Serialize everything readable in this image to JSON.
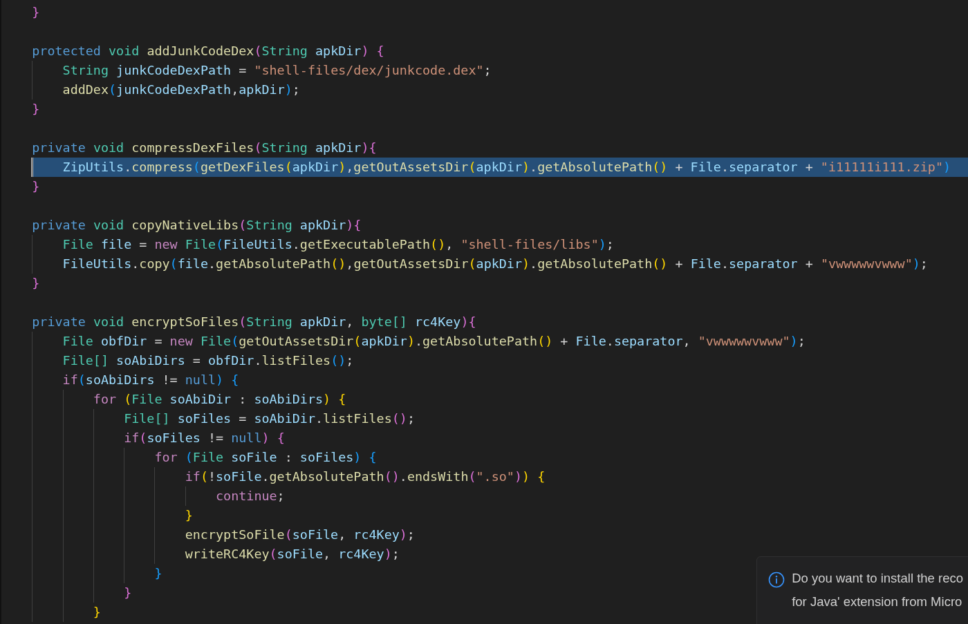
{
  "editor": {
    "lines": [
      {
        "selected": false,
        "tokens": [
          {
            "kind": "m",
            "text": "    }"
          }
        ]
      },
      {
        "selected": false
      },
      {
        "selected": false,
        "tokens": [
          {
            "kind": "mod",
            "text": "    protected "
          },
          {
            "kind": "type",
            "text": "void "
          },
          {
            "kind": "fn",
            "text": "addJunkCodeDex"
          },
          {
            "kind": "m",
            "text": "("
          },
          {
            "kind": "type",
            "text": "String "
          },
          {
            "kind": "var",
            "text": "apkDir"
          },
          {
            "kind": "m",
            "text": ") "
          },
          {
            "kind": "m",
            "text": "{"
          }
        ]
      },
      {
        "selected": false,
        "tokens": [
          {
            "kind": "type",
            "text": "        String "
          },
          {
            "kind": "var",
            "text": "junkCodeDexPath"
          },
          {
            "kind": "p",
            "text": " = "
          },
          {
            "kind": "str",
            "text": "\"shell-files/dex/junkcode.dex\""
          },
          {
            "kind": "p",
            "text": ";"
          }
        ]
      },
      {
        "selected": false,
        "tokens": [
          {
            "kind": "fn",
            "text": "        addDex"
          },
          {
            "kind": "c",
            "text": "("
          },
          {
            "kind": "var",
            "text": "junkCodeDexPath"
          },
          {
            "kind": "p",
            "text": ","
          },
          {
            "kind": "var",
            "text": "apkDir"
          },
          {
            "kind": "c",
            "text": ")"
          },
          {
            "kind": "p",
            "text": ";"
          }
        ]
      },
      {
        "selected": false,
        "tokens": [
          {
            "kind": "m",
            "text": "    }"
          }
        ]
      },
      {
        "selected": false
      },
      {
        "selected": false,
        "tokens": [
          {
            "kind": "mod",
            "text": "    private "
          },
          {
            "kind": "type",
            "text": "void "
          },
          {
            "kind": "fn",
            "text": "compressDexFiles"
          },
          {
            "kind": "m",
            "text": "("
          },
          {
            "kind": "type",
            "text": "String "
          },
          {
            "kind": "var",
            "text": "apkDir"
          },
          {
            "kind": "m",
            "text": "){"
          }
        ]
      },
      {
        "selected": true,
        "tokens": [
          {
            "kind": "var",
            "text": "        ZipUtils"
          },
          {
            "kind": "p",
            "text": "."
          },
          {
            "kind": "fn",
            "text": "compress"
          },
          {
            "kind": "c",
            "text": "("
          },
          {
            "kind": "fn",
            "text": "getDexFiles"
          },
          {
            "kind": "y",
            "text": "("
          },
          {
            "kind": "var",
            "text": "apkDir"
          },
          {
            "kind": "y",
            "text": ")"
          },
          {
            "kind": "p",
            "text": ","
          },
          {
            "kind": "fn",
            "text": "getOutAssetsDir"
          },
          {
            "kind": "y",
            "text": "("
          },
          {
            "kind": "var",
            "text": "apkDir"
          },
          {
            "kind": "y",
            "text": ")"
          },
          {
            "kind": "p",
            "text": "."
          },
          {
            "kind": "fn",
            "text": "getAbsolutePath"
          },
          {
            "kind": "y",
            "text": "()"
          },
          {
            "kind": "p",
            "text": " + "
          },
          {
            "kind": "var",
            "text": "File"
          },
          {
            "kind": "p",
            "text": "."
          },
          {
            "kind": "var",
            "text": "separator"
          },
          {
            "kind": "p",
            "text": " + "
          },
          {
            "kind": "str",
            "text": "\"i11111i111.zip\""
          },
          {
            "kind": "c",
            "text": ")"
          }
        ]
      },
      {
        "selected": false,
        "tokens": [
          {
            "kind": "m",
            "text": "    }"
          }
        ]
      },
      {
        "selected": false
      },
      {
        "selected": false,
        "tokens": [
          {
            "kind": "mod",
            "text": "    private "
          },
          {
            "kind": "type",
            "text": "void "
          },
          {
            "kind": "fn",
            "text": "copyNativeLibs"
          },
          {
            "kind": "m",
            "text": "("
          },
          {
            "kind": "type",
            "text": "String "
          },
          {
            "kind": "var",
            "text": "apkDir"
          },
          {
            "kind": "m",
            "text": "){"
          }
        ]
      },
      {
        "selected": false,
        "tokens": [
          {
            "kind": "type",
            "text": "        File "
          },
          {
            "kind": "var",
            "text": "file"
          },
          {
            "kind": "p",
            "text": " = "
          },
          {
            "kind": "ctl",
            "text": "new "
          },
          {
            "kind": "type",
            "text": "File"
          },
          {
            "kind": "c",
            "text": "("
          },
          {
            "kind": "var",
            "text": "FileUtils"
          },
          {
            "kind": "p",
            "text": "."
          },
          {
            "kind": "fn",
            "text": "getExecutablePath"
          },
          {
            "kind": "y",
            "text": "()"
          },
          {
            "kind": "p",
            "text": ", "
          },
          {
            "kind": "str",
            "text": "\"shell-files/libs\""
          },
          {
            "kind": "c",
            "text": ")"
          },
          {
            "kind": "p",
            "text": ";"
          }
        ]
      },
      {
        "selected": false,
        "tokens": [
          {
            "kind": "var",
            "text": "        FileUtils"
          },
          {
            "kind": "p",
            "text": "."
          },
          {
            "kind": "fn",
            "text": "copy"
          },
          {
            "kind": "c",
            "text": "("
          },
          {
            "kind": "var",
            "text": "file"
          },
          {
            "kind": "p",
            "text": "."
          },
          {
            "kind": "fn",
            "text": "getAbsolutePath"
          },
          {
            "kind": "y",
            "text": "()"
          },
          {
            "kind": "p",
            "text": ","
          },
          {
            "kind": "fn",
            "text": "getOutAssetsDir"
          },
          {
            "kind": "y",
            "text": "("
          },
          {
            "kind": "var",
            "text": "apkDir"
          },
          {
            "kind": "y",
            "text": ")"
          },
          {
            "kind": "p",
            "text": "."
          },
          {
            "kind": "fn",
            "text": "getAbsolutePath"
          },
          {
            "kind": "y",
            "text": "()"
          },
          {
            "kind": "p",
            "text": " + "
          },
          {
            "kind": "var",
            "text": "File"
          },
          {
            "kind": "p",
            "text": "."
          },
          {
            "kind": "var",
            "text": "separator"
          },
          {
            "kind": "p",
            "text": " + "
          },
          {
            "kind": "str",
            "text": "\"vwwwwwvwww\""
          },
          {
            "kind": "c",
            "text": ")"
          },
          {
            "kind": "p",
            "text": ";"
          }
        ]
      },
      {
        "selected": false,
        "tokens": [
          {
            "kind": "m",
            "text": "    }"
          }
        ]
      },
      {
        "selected": false
      },
      {
        "selected": false,
        "tokens": [
          {
            "kind": "mod",
            "text": "    private "
          },
          {
            "kind": "type",
            "text": "void "
          },
          {
            "kind": "fn",
            "text": "encryptSoFiles"
          },
          {
            "kind": "m",
            "text": "("
          },
          {
            "kind": "type",
            "text": "String "
          },
          {
            "kind": "var",
            "text": "apkDir"
          },
          {
            "kind": "p",
            "text": ", "
          },
          {
            "kind": "type",
            "text": "byte[] "
          },
          {
            "kind": "var",
            "text": "rc4Key"
          },
          {
            "kind": "m",
            "text": "){"
          }
        ]
      },
      {
        "selected": false,
        "tokens": [
          {
            "kind": "type",
            "text": "        File "
          },
          {
            "kind": "var",
            "text": "obfDir"
          },
          {
            "kind": "p",
            "text": " = "
          },
          {
            "kind": "ctl",
            "text": "new "
          },
          {
            "kind": "type",
            "text": "File"
          },
          {
            "kind": "c",
            "text": "("
          },
          {
            "kind": "fn",
            "text": "getOutAssetsDir"
          },
          {
            "kind": "y",
            "text": "("
          },
          {
            "kind": "var",
            "text": "apkDir"
          },
          {
            "kind": "y",
            "text": ")"
          },
          {
            "kind": "p",
            "text": "."
          },
          {
            "kind": "fn",
            "text": "getAbsolutePath"
          },
          {
            "kind": "y",
            "text": "()"
          },
          {
            "kind": "p",
            "text": " + "
          },
          {
            "kind": "var",
            "text": "File"
          },
          {
            "kind": "p",
            "text": "."
          },
          {
            "kind": "var",
            "text": "separator"
          },
          {
            "kind": "p",
            "text": ", "
          },
          {
            "kind": "str",
            "text": "\"vwwwwwvwww\""
          },
          {
            "kind": "c",
            "text": ")"
          },
          {
            "kind": "p",
            "text": ";"
          }
        ]
      },
      {
        "selected": false,
        "tokens": [
          {
            "kind": "type",
            "text": "        File[] "
          },
          {
            "kind": "var",
            "text": "soAbiDirs"
          },
          {
            "kind": "p",
            "text": " = "
          },
          {
            "kind": "var",
            "text": "obfDir"
          },
          {
            "kind": "p",
            "text": "."
          },
          {
            "kind": "fn",
            "text": "listFiles"
          },
          {
            "kind": "c",
            "text": "()"
          },
          {
            "kind": "p",
            "text": ";"
          }
        ]
      },
      {
        "selected": false,
        "tokens": [
          {
            "kind": "ctl",
            "text": "        if"
          },
          {
            "kind": "c",
            "text": "("
          },
          {
            "kind": "var",
            "text": "soAbiDirs"
          },
          {
            "kind": "p",
            "text": " != "
          },
          {
            "kind": "mod",
            "text": "null"
          },
          {
            "kind": "c",
            "text": ") "
          },
          {
            "kind": "c",
            "text": "{"
          }
        ]
      },
      {
        "selected": false,
        "tokens": [
          {
            "kind": "ctl",
            "text": "            for "
          },
          {
            "kind": "y",
            "text": "("
          },
          {
            "kind": "type",
            "text": "File "
          },
          {
            "kind": "var",
            "text": "soAbiDir"
          },
          {
            "kind": "p",
            "text": " : "
          },
          {
            "kind": "var",
            "text": "soAbiDirs"
          },
          {
            "kind": "y",
            "text": ") "
          },
          {
            "kind": "y",
            "text": "{"
          }
        ]
      },
      {
        "selected": false,
        "tokens": [
          {
            "kind": "type",
            "text": "                File[] "
          },
          {
            "kind": "var",
            "text": "soFiles"
          },
          {
            "kind": "p",
            "text": " = "
          },
          {
            "kind": "var",
            "text": "soAbiDir"
          },
          {
            "kind": "p",
            "text": "."
          },
          {
            "kind": "fn",
            "text": "listFiles"
          },
          {
            "kind": "m",
            "text": "()"
          },
          {
            "kind": "p",
            "text": ";"
          }
        ]
      },
      {
        "selected": false,
        "tokens": [
          {
            "kind": "ctl",
            "text": "                if"
          },
          {
            "kind": "m",
            "text": "("
          },
          {
            "kind": "var",
            "text": "soFiles"
          },
          {
            "kind": "p",
            "text": " != "
          },
          {
            "kind": "mod",
            "text": "null"
          },
          {
            "kind": "m",
            "text": ") "
          },
          {
            "kind": "m",
            "text": "{"
          }
        ]
      },
      {
        "selected": false,
        "tokens": [
          {
            "kind": "ctl",
            "text": "                    for "
          },
          {
            "kind": "c",
            "text": "("
          },
          {
            "kind": "type",
            "text": "File "
          },
          {
            "kind": "var",
            "text": "soFile"
          },
          {
            "kind": "p",
            "text": " : "
          },
          {
            "kind": "var",
            "text": "soFiles"
          },
          {
            "kind": "c",
            "text": ") "
          },
          {
            "kind": "c",
            "text": "{"
          }
        ]
      },
      {
        "selected": false,
        "tokens": [
          {
            "kind": "ctl",
            "text": "                        if"
          },
          {
            "kind": "y",
            "text": "("
          },
          {
            "kind": "p",
            "text": "!"
          },
          {
            "kind": "var",
            "text": "soFile"
          },
          {
            "kind": "p",
            "text": "."
          },
          {
            "kind": "fn",
            "text": "getAbsolutePath"
          },
          {
            "kind": "m",
            "text": "()"
          },
          {
            "kind": "p",
            "text": "."
          },
          {
            "kind": "fn",
            "text": "endsWith"
          },
          {
            "kind": "m",
            "text": "("
          },
          {
            "kind": "str",
            "text": "\".so\""
          },
          {
            "kind": "m",
            "text": ")"
          },
          {
            "kind": "y",
            "text": ") "
          },
          {
            "kind": "y",
            "text": "{"
          }
        ]
      },
      {
        "selected": false,
        "tokens": [
          {
            "kind": "ctl",
            "text": "                            continue"
          },
          {
            "kind": "p",
            "text": ";"
          }
        ]
      },
      {
        "selected": false,
        "tokens": [
          {
            "kind": "y",
            "text": "                        }"
          }
        ]
      },
      {
        "selected": false,
        "tokens": [
          {
            "kind": "fn",
            "text": "                        encryptSoFile"
          },
          {
            "kind": "m",
            "text": "("
          },
          {
            "kind": "var",
            "text": "soFile"
          },
          {
            "kind": "p",
            "text": ", "
          },
          {
            "kind": "var",
            "text": "rc4Key"
          },
          {
            "kind": "m",
            "text": ")"
          },
          {
            "kind": "p",
            "text": ";"
          }
        ]
      },
      {
        "selected": false,
        "tokens": [
          {
            "kind": "fn",
            "text": "                        writeRC4Key"
          },
          {
            "kind": "m",
            "text": "("
          },
          {
            "kind": "var",
            "text": "soFile"
          },
          {
            "kind": "p",
            "text": ", "
          },
          {
            "kind": "var",
            "text": "rc4Key"
          },
          {
            "kind": "m",
            "text": ")"
          },
          {
            "kind": "p",
            "text": ";"
          }
        ]
      },
      {
        "selected": false,
        "tokens": [
          {
            "kind": "c",
            "text": "                    }"
          }
        ]
      },
      {
        "selected": false,
        "tokens": [
          {
            "kind": "m",
            "text": "                }"
          }
        ]
      },
      {
        "selected": false,
        "tokens": [
          {
            "kind": "y",
            "text": "            }"
          }
        ]
      }
    ]
  },
  "notification": {
    "lines": [
      "Do you want to install the reco",
      "for Java' extension from Micro"
    ]
  }
}
